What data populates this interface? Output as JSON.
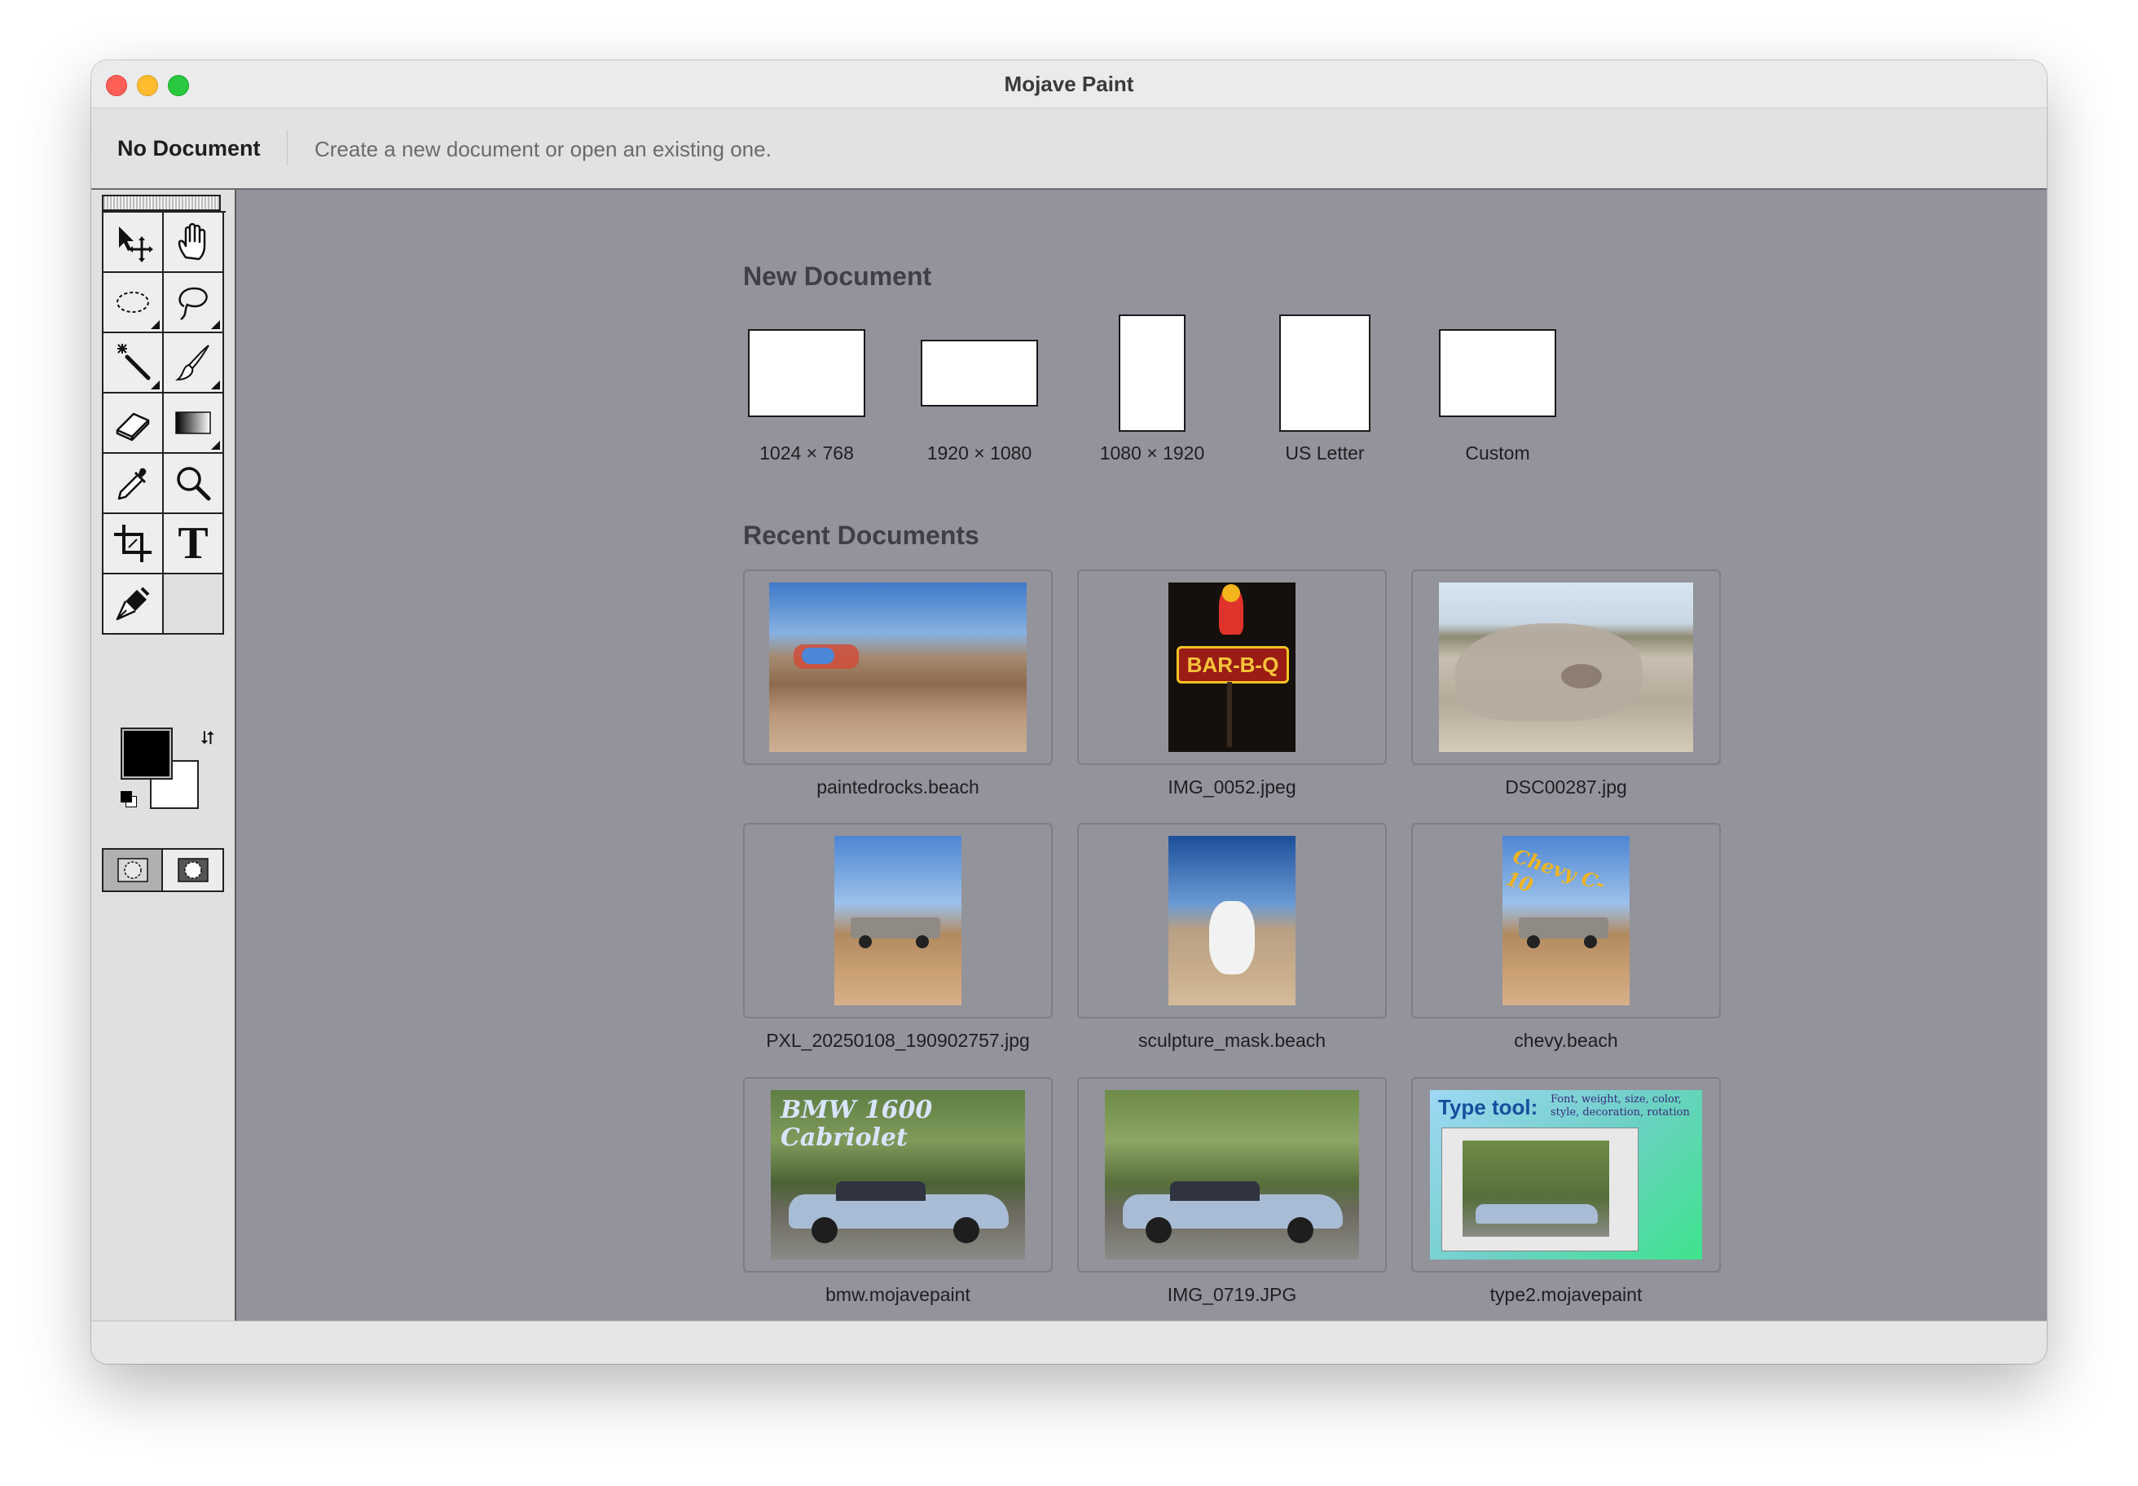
{
  "window": {
    "title": "Mojave Paint"
  },
  "docbar": {
    "doc_name": "No Document",
    "hint": "Create a new document or open an existing one."
  },
  "tools": [
    "move-tool",
    "hand-tool",
    "marquee-tool",
    "lasso-tool",
    "magic-wand-tool",
    "brush-tool",
    "eraser-tool",
    "gradient-tool",
    "eyedropper-tool",
    "zoom-tool",
    "crop-tool",
    "text-tool",
    "pen-tool"
  ],
  "colors": {
    "foreground": "#000000",
    "background": "#ffffff",
    "canvas_bg": "#93939c"
  },
  "new_document": {
    "title": "New Document",
    "presets": [
      {
        "label": "1024 × 768"
      },
      {
        "label": "1920 × 1080"
      },
      {
        "label": "1080 × 1920"
      },
      {
        "label": "US Letter"
      },
      {
        "label": "Custom"
      }
    ]
  },
  "recent_documents": {
    "title": "Recent Documents",
    "items": [
      {
        "name": "paintedrocks.beach",
        "caption": ""
      },
      {
        "name": "IMG_0052.jpeg",
        "caption": "BAR-B-Q"
      },
      {
        "name": "DSC00287.jpg",
        "caption": ""
      },
      {
        "name": "PXL_20250108_190902757.jpg",
        "caption": ""
      },
      {
        "name": "sculpture_mask.beach",
        "caption": ""
      },
      {
        "name": "chevy.beach",
        "caption": "Chevy C-10"
      },
      {
        "name": "bmw.mojavepaint",
        "caption": "BMW 1600 Cabriolet"
      },
      {
        "name": "IMG_0719.JPG",
        "caption": ""
      },
      {
        "name": "type2.mojavepaint",
        "caption": "Type tool:",
        "caption2": "Font, weight, size, color, style, decoration, rotation"
      }
    ]
  }
}
